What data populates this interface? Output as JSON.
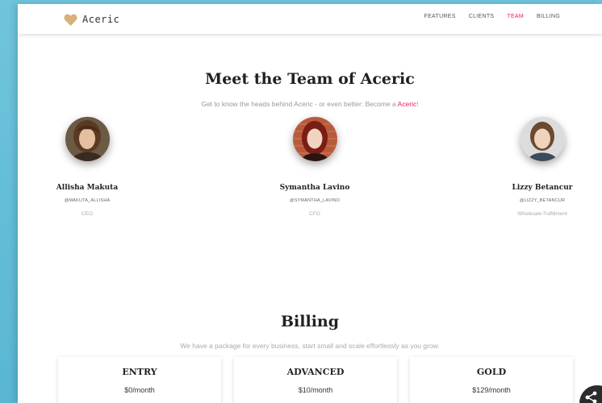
{
  "brand": {
    "name": "Aceric",
    "icon": "heart-icon",
    "icon_color": "#d9b07a"
  },
  "nav": {
    "items": [
      {
        "label": "FEATURES",
        "active": false
      },
      {
        "label": "CLIENTS",
        "active": false
      },
      {
        "label": "TEAM",
        "active": true
      },
      {
        "label": "BILLING",
        "active": false
      }
    ],
    "active_color": "#e91e63"
  },
  "team": {
    "title": "Meet the Team of Aceric",
    "subtitle_prefix": "Get to know the heads behind Aceric - or even better: Become a ",
    "subtitle_link": "Aceric",
    "subtitle_suffix": "!",
    "members": [
      {
        "name": "Allisha Makuta",
        "handle": "@MAKUTA_ALLISHA",
        "role": "CEO"
      },
      {
        "name": "Symantha Lavino",
        "handle": "@SYMANTHA_LAVINO",
        "role": "CFO"
      },
      {
        "name": "Lizzy Betancur",
        "handle": "@LIZZY_BETANCUR",
        "role": "Wholesale Fulfillment"
      }
    ]
  },
  "billing": {
    "title": "Billing",
    "subtitle": "We have a package for every business, start small and scale effortlessly as you grow.",
    "plans": [
      {
        "name": "ENTRY",
        "price": "$0/month"
      },
      {
        "name": "ADVANCED",
        "price": "$10/month"
      },
      {
        "name": "GOLD",
        "price": "$129/month"
      }
    ]
  },
  "share": {
    "icon": "share-icon"
  }
}
